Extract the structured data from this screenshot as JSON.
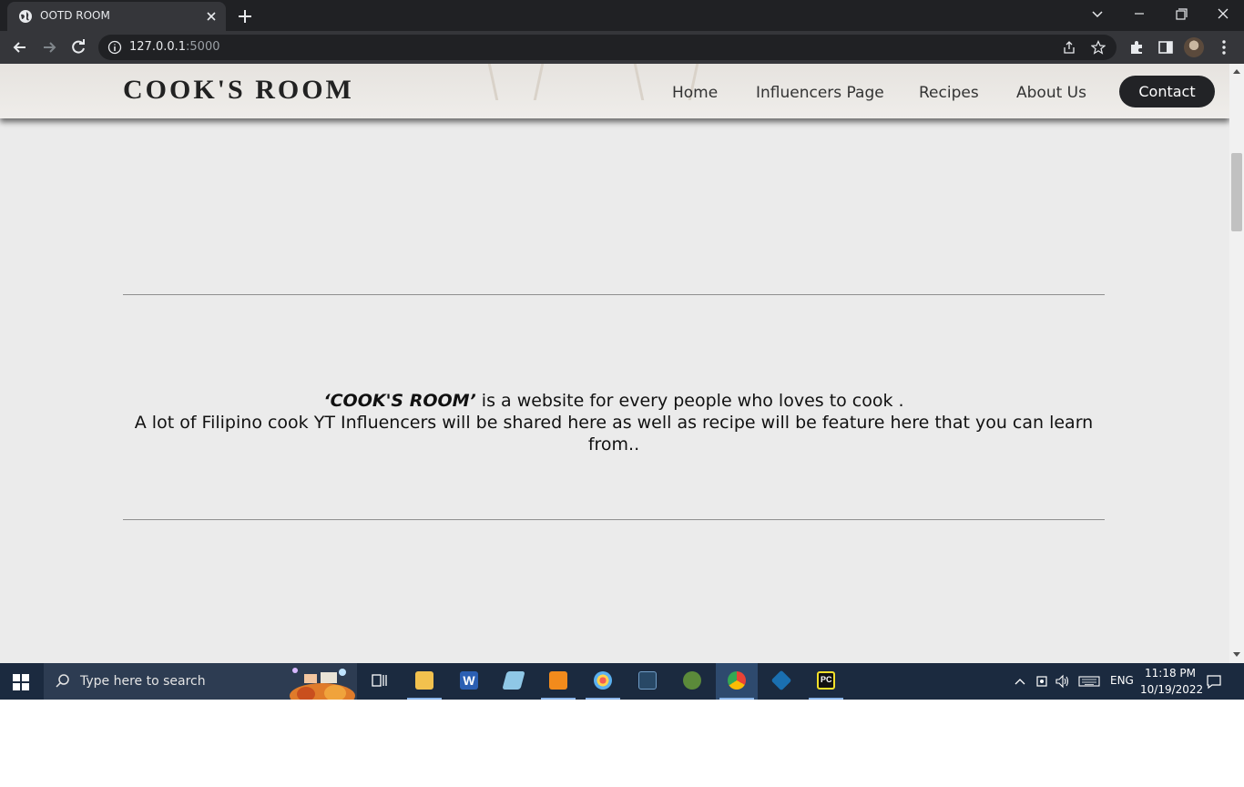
{
  "browser": {
    "tab_title": "OOTD ROOM",
    "url_host": "127.0.0.1",
    "url_port": ":5000"
  },
  "site": {
    "logo": "COOK'S ROOM",
    "nav": {
      "home": "Home",
      "influencers": "Influencers Page",
      "recipes": "Recipes",
      "about": "About Us",
      "contact": "Contact"
    },
    "intro": {
      "brand": "‘COOK'S ROOM’",
      "line1_rest": " is a website for every people who loves to cook .",
      "line2": "A lot of Filipino cook YT Influencers will be shared here as well as recipe will be feature here that you can learn from.."
    }
  },
  "taskbar": {
    "search_placeholder": "Type here to search",
    "language": "ENG",
    "time": "11:18 PM",
    "date": "10/19/2022",
    "apps": [
      "task-view",
      "file-explorer",
      "word",
      "notepad",
      "sublime-text",
      "paint",
      "mysql-workbench",
      "git-gui",
      "chrome",
      "virtualbox",
      "pycharm"
    ]
  },
  "colors": {
    "page_bg": "#ebebeb",
    "contact_button": "#222326",
    "browser_dark": "#202124",
    "taskbar": "#1b2a3f"
  }
}
